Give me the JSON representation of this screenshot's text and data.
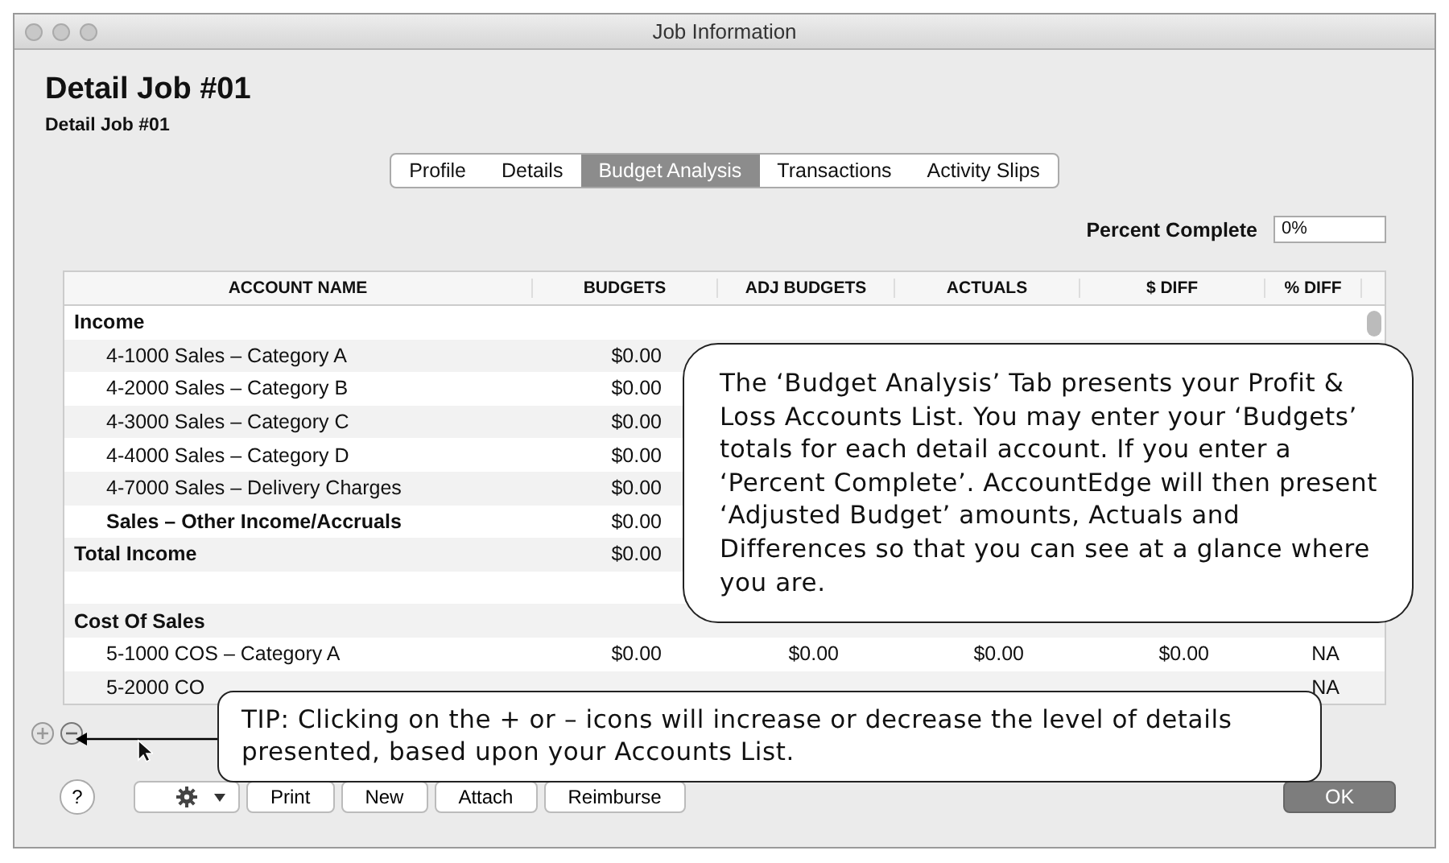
{
  "window": {
    "title": "Job Information"
  },
  "job": {
    "title": "Detail Job #01",
    "subtitle": "Detail Job #01"
  },
  "tabs": [
    {
      "label": "Profile",
      "selected": false
    },
    {
      "label": "Details",
      "selected": false
    },
    {
      "label": "Budget Analysis",
      "selected": true
    },
    {
      "label": "Transactions",
      "selected": false
    },
    {
      "label": "Activity Slips",
      "selected": false
    }
  ],
  "percent_complete": {
    "label": "Percent Complete",
    "value": "0%"
  },
  "table": {
    "columns": [
      "ACCOUNT NAME",
      "BUDGETS",
      "ADJ BUDGETS",
      "ACTUALS",
      "$ DIFF",
      "% DIFF"
    ],
    "rows": [
      {
        "kind": "header",
        "cells": [
          "Income"
        ]
      },
      {
        "kind": "account",
        "cells": [
          "4-1000  Sales – Category A",
          "$0.00"
        ]
      },
      {
        "kind": "account",
        "cells": [
          "4-2000  Sales – Category B",
          "$0.00"
        ]
      },
      {
        "kind": "account",
        "cells": [
          "4-3000  Sales – Category C",
          "$0.00"
        ]
      },
      {
        "kind": "account",
        "cells": [
          "4-4000  Sales – Category D",
          "$0.00"
        ]
      },
      {
        "kind": "account",
        "cells": [
          "4-7000  Sales – Delivery Charges",
          "$0.00"
        ]
      },
      {
        "kind": "subtotal",
        "cells": [
          "Sales – Other Income/Accruals",
          "$0.00"
        ]
      },
      {
        "kind": "header",
        "cells": [
          "Total Income",
          "$0.00"
        ]
      },
      {
        "kind": "blank",
        "cells": []
      },
      {
        "kind": "header",
        "cells": [
          "Cost Of Sales"
        ]
      },
      {
        "kind": "account",
        "cells": [
          "5-1000  COS – Category A",
          "$0.00",
          "$0.00",
          "$0.00",
          "$0.00",
          "NA"
        ]
      },
      {
        "kind": "account",
        "cells": [
          "5-2000  CO",
          "",
          "",
          "",
          "",
          "NA"
        ]
      }
    ]
  },
  "callouts": [
    {
      "kind": "note",
      "text": "The ‘Budget Analysis’ Tab presents your Profit & Loss Accounts List. You may enter your ‘Budgets’ totals for each detail account. If you enter a ‘Percent Complete’. AccountEdge will then present ‘Adjusted Budget’ amounts, Actuals and Differences so that you can see at a glance where you are."
    },
    {
      "kind": "tip",
      "text": "TIP: Clicking on the + or – icons will increase or decrease the level of details presented, based upon your Accounts List."
    }
  ],
  "footer": {
    "help": "?",
    "buttons": [
      "Print",
      "New",
      "Attach",
      "Reimburse"
    ],
    "ok": "OK"
  }
}
